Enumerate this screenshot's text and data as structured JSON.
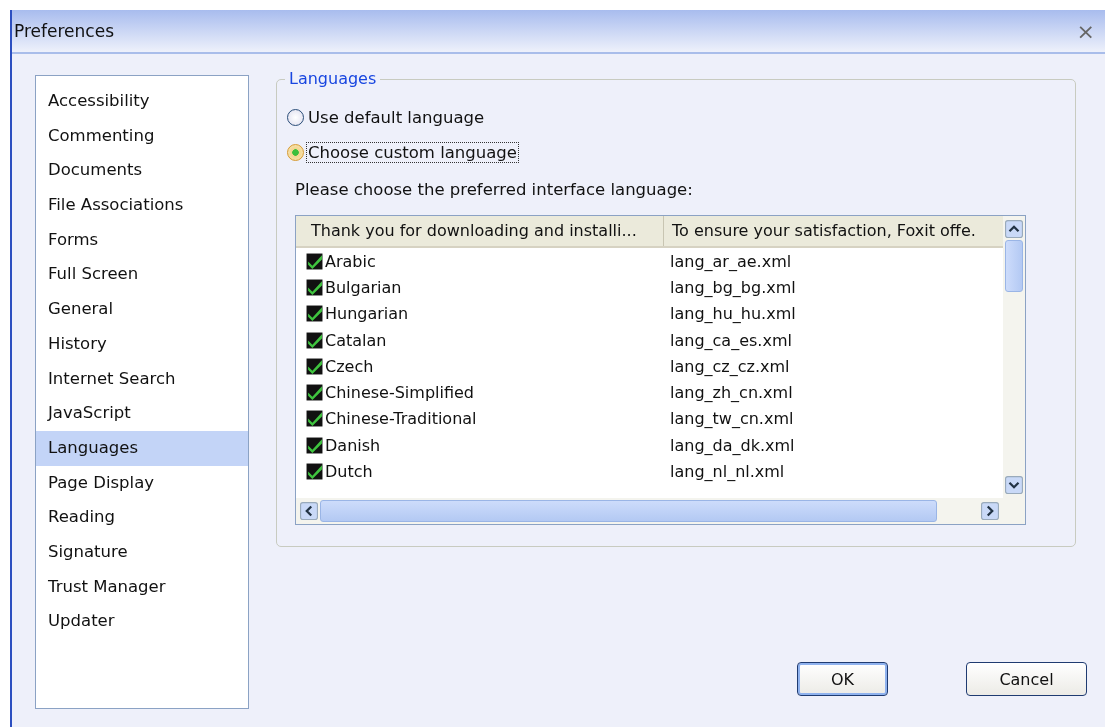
{
  "window": {
    "title": "Preferences",
    "close": "×"
  },
  "sidebar": {
    "items": [
      {
        "label": "Accessibility",
        "selected": false
      },
      {
        "label": "Commenting",
        "selected": false
      },
      {
        "label": "Documents",
        "selected": false
      },
      {
        "label": "File Associations",
        "selected": false
      },
      {
        "label": "Forms",
        "selected": false
      },
      {
        "label": "Full Screen",
        "selected": false
      },
      {
        "label": "General",
        "selected": false
      },
      {
        "label": "History",
        "selected": false
      },
      {
        "label": "Internet Search",
        "selected": false
      },
      {
        "label": "JavaScript",
        "selected": false
      },
      {
        "label": "Languages",
        "selected": true
      },
      {
        "label": "Page Display",
        "selected": false
      },
      {
        "label": "Reading",
        "selected": false
      },
      {
        "label": "Signature",
        "selected": false
      },
      {
        "label": "Trust Manager",
        "selected": false
      },
      {
        "label": "Updater",
        "selected": false
      }
    ]
  },
  "group": {
    "title": "Languages",
    "options": [
      {
        "label": "Use default language",
        "selected": false
      },
      {
        "label": "Choose custom language",
        "selected": true
      }
    ],
    "prompt": "Please choose the preferred interface language:",
    "table": {
      "columns": [
        "Thank you for downloading and installi...",
        "To ensure your satisfaction, Foxit offe."
      ],
      "rows": [
        {
          "name": "Arabic",
          "file": "lang_ar_ae.xml",
          "checked": true
        },
        {
          "name": "Bulgarian",
          "file": "lang_bg_bg.xml",
          "checked": true
        },
        {
          "name": "Hungarian",
          "file": "lang_hu_hu.xml",
          "checked": true
        },
        {
          "name": "Catalan",
          "file": "lang_ca_es.xml",
          "checked": true
        },
        {
          "name": "Czech",
          "file": "lang_cz_cz.xml",
          "checked": true
        },
        {
          "name": "Chinese-Simplified",
          "file": "lang_zh_cn.xml",
          "checked": true
        },
        {
          "name": "Chinese-Traditional",
          "file": "lang_tw_cn.xml",
          "checked": true
        },
        {
          "name": "Danish",
          "file": "lang_da_dk.xml",
          "checked": true
        },
        {
          "name": "Dutch",
          "file": "lang_nl_nl.xml",
          "checked": true
        }
      ]
    }
  },
  "buttons": [
    "OK",
    "Cancel"
  ]
}
